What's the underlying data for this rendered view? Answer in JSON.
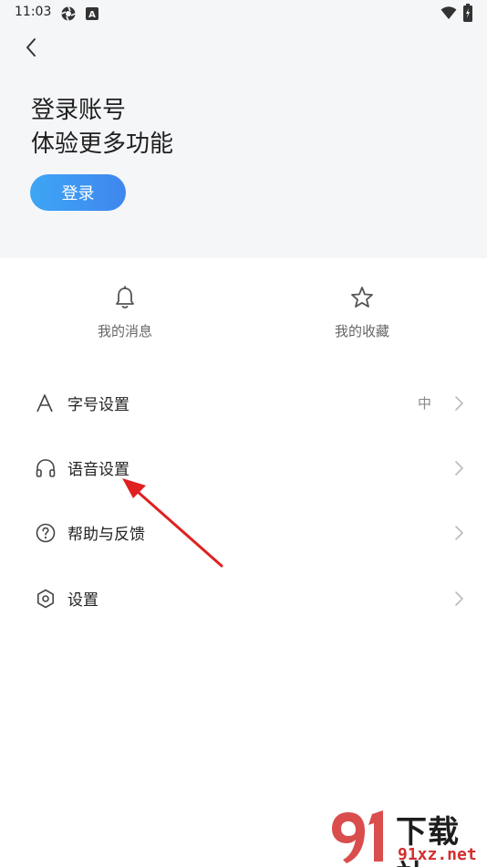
{
  "status_bar": {
    "time": "11:03",
    "a_badge": "A"
  },
  "header": {
    "login_title": "登录账号",
    "login_subtitle": "体验更多功能",
    "login_button": "登录"
  },
  "quick_actions": [
    {
      "label": "我的消息",
      "icon": "bell-icon"
    },
    {
      "label": "我的收藏",
      "icon": "star-icon"
    }
  ],
  "menu": [
    {
      "label": "字号设置",
      "value": "中",
      "icon": "font-size-icon"
    },
    {
      "label": "语音设置",
      "value": "",
      "icon": "headphones-icon"
    },
    {
      "label": "帮助与反馈",
      "value": "",
      "icon": "help-icon"
    },
    {
      "label": "设置",
      "value": "",
      "icon": "settings-icon"
    }
  ],
  "watermark": {
    "brand": "下载站",
    "url": "91xz.net"
  },
  "colors": {
    "header_bg": "#f5f6f8",
    "accent": "#3f8fef",
    "annotation": "#e02020"
  }
}
